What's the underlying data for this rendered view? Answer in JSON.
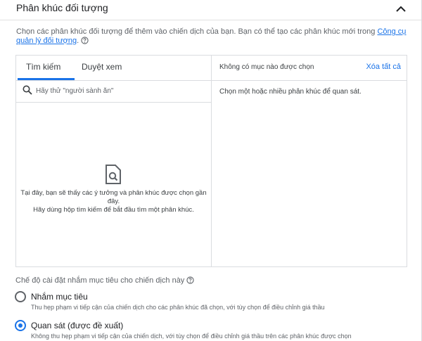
{
  "section": {
    "title": "Phân khúc đối tượng",
    "description": "Chọn các phân khúc đối tượng để thêm vào chiến dịch của bạn. Bạn có thể tạo các phân khúc mới trong ",
    "link": "Công cụ quản lý đối tượng",
    "description_end": "."
  },
  "tabs": [
    "Tìm kiếm",
    "Duyệt xem"
  ],
  "search": {
    "placeholder": "Hãy thử \"người sành ăn\""
  },
  "empty": {
    "line1": "Tại đây, bạn sẽ thấy các ý tưởng và phân khúc được chọn gần đây.",
    "line2": "Hãy dùng hộp tìm kiếm để bắt đầu tìm một phân khúc."
  },
  "selected": {
    "none_label": "Không có mục nào được chọn",
    "clear_all": "Xóa tất cả",
    "hint": "Chọn một hoặc nhiều phân khúc để quan sát."
  },
  "targeting": {
    "label": "Chế độ cài đặt nhắm mục tiêu cho chiến dịch này",
    "options": [
      {
        "title": "Nhắm mục tiêu",
        "description": "Thu hẹp phạm vi tiếp cận của chiến dịch cho các phân khúc đã chọn, với tùy chọn để điều chỉnh giá thầu",
        "selected": false
      },
      {
        "title": "Quan sát (được đề xuất)",
        "description": "Không thu hẹp phạm vi tiếp cận của chiến dịch, với tùy chọn để điều chỉnh giá thầu trên các phân khúc được chọn",
        "selected": true
      }
    ]
  },
  "colors": {
    "accent": "#1a73e8",
    "text": "#3c4043",
    "muted": "#5f6368",
    "border": "#dadce0"
  }
}
